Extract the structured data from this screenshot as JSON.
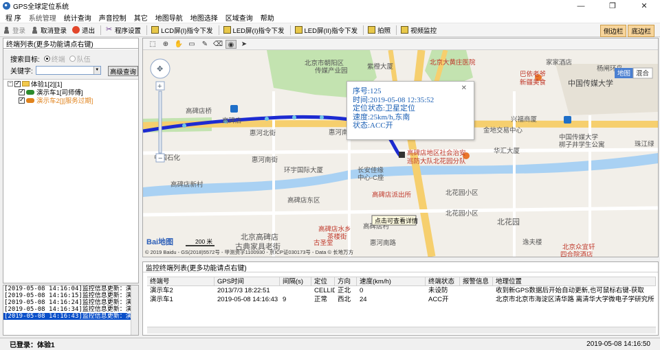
{
  "window": {
    "title": "GPS全球定位系统",
    "min": "—",
    "max": "❐",
    "close": "✕"
  },
  "menu": [
    {
      "label": "程 序",
      "dim": false
    },
    {
      "label": "系统管理",
      "dim": true
    },
    {
      "label": "统计查询",
      "dim": false
    },
    {
      "label": "声音控制",
      "dim": false
    },
    {
      "label": "其它",
      "dim": false
    },
    {
      "label": "地图导航",
      "dim": false
    },
    {
      "label": "地图选择",
      "dim": false
    },
    {
      "label": "区域查询",
      "dim": false
    },
    {
      "label": "帮助",
      "dim": false
    }
  ],
  "toolbar": {
    "login": "登录",
    "cancel_login": "取消登录",
    "exit": "退出",
    "settings": "程序设置",
    "lcd1": "LCD屏(I)指令下发",
    "led1": "LED屏(I)指令下发",
    "led2": "LED屏(II)指令下发",
    "photo": "拍照",
    "video": "视频监控",
    "sidebar": "侧边栏",
    "bottombar": "底边栏"
  },
  "terminal_panel": {
    "title": "终端列表(更多功能请点右键)",
    "search_target_label": "搜索目标:",
    "opt_terminal": "终端",
    "opt_team": "队伍",
    "keyword_label": "关键字:",
    "keyword_value": "",
    "advanced_button": "高级查询",
    "group": "体验1[2][1]",
    "vehicles": [
      {
        "label": "演示车1[司师傅]",
        "color": "#2c8a2c",
        "online": true
      },
      {
        "label": "演示车2[][服务过期]",
        "color": "#e0831d",
        "online": false
      }
    ]
  },
  "log": [
    "[2019-05-08 14:16:04]监控信息更新：演示车",
    "[2019-05-08 14:16:15]监控信息更新：演示车",
    "[2019-05-08 14:16:24]监控信息更新：演示车",
    "[2019-05-08 14:16:34]监控信息更新：演示车",
    "[2019-05-08 14:16:43]监控信息更新：演示车"
  ],
  "map": {
    "type_map": "地图",
    "type_hybrid": "混合",
    "scale": "200 米",
    "copyright": "© 2019 Baidu - GS(2018)5572号 - 甲测资字1100930 - 京ICP证030173号 - Data © 长地万方",
    "logo": "Bai地图",
    "tooltip": "点击可查看详情",
    "accent": "#3b5bdb",
    "labels": {
      "l1": "北京市朝阳区",
      "l2": "传媒产业园",
      "l3": "紫橙大厦",
      "l4": "北京大黄庄医院",
      "l5": "巴依老爷",
      "l6": "新疆美食",
      "l7": "家家酒店",
      "l8": "中国传媒大学",
      "l9": "高碑店桥",
      "l10": "高碑店",
      "l11": "惠河北街",
      "l12": "中国石化",
      "l13": "惠河南街",
      "l14": "环宇国际大厦",
      "l15": "长安佳缘",
      "l16": "中心-C座",
      "l17": "高碑店地区社会治安",
      "l18": "巡防大队北花园分队",
      "l19": "金地交易中心",
      "l20": "兴福商厦",
      "l21": "华汇大厦",
      "l22": "中国传媒大学",
      "l23": "梆子井学生公寓",
      "l24": "珠江绿",
      "l25": "高碑店新村",
      "l26": "高碑店派出所",
      "l27": "北花园小区",
      "l28": "高碑店东区",
      "l29": "北花园",
      "l30": "北京高碑店",
      "l31": "古典家具老街",
      "l32": "高碑店水乡",
      "l33": "茶楼街",
      "l34": "北京众宜轩",
      "l35": "四合院酒店",
      "l36": "古圣堂",
      "l37": "惠河南路",
      "l38": "高碑店村",
      "l39": "逸夫楼",
      "l40": "杨闸环岛",
      "l41": "惠河南街",
      "l42": "北花园小区"
    }
  },
  "popup": {
    "seq": "序号:125",
    "time": "时间:2019-05-08 12:35:52",
    "locate": "定位状态:卫星定位",
    "speed": "速度:25km/h,东南",
    "status": "状态:ACC开",
    "close": "✕"
  },
  "monitor": {
    "title": "监控终端列表(更多功能请点右键)",
    "columns": [
      "终端号",
      "GPS时间",
      "间隔(s)",
      "定位",
      "方向",
      "速度(km/h)",
      "终端状态",
      "报警信息",
      "地理位置"
    ],
    "rows": [
      [
        "演示车2",
        "2013/7/3 18:22:51",
        "",
        "CELLID",
        "正北",
        "0",
        "未设防",
        "",
        "收到新GPS数据后开始自动更新,也可鼠标右键-获取"
      ],
      [
        "演示车1",
        "2019-05-08 14:16:43",
        "9",
        "正常",
        "西北",
        "24",
        "ACC开",
        "",
        "北京市北京市海淀区清华路 离清华大学微电子学研究所"
      ]
    ]
  },
  "status": {
    "login": "已登录：体验1",
    "time": "2019-05-08 14:16:50"
  }
}
